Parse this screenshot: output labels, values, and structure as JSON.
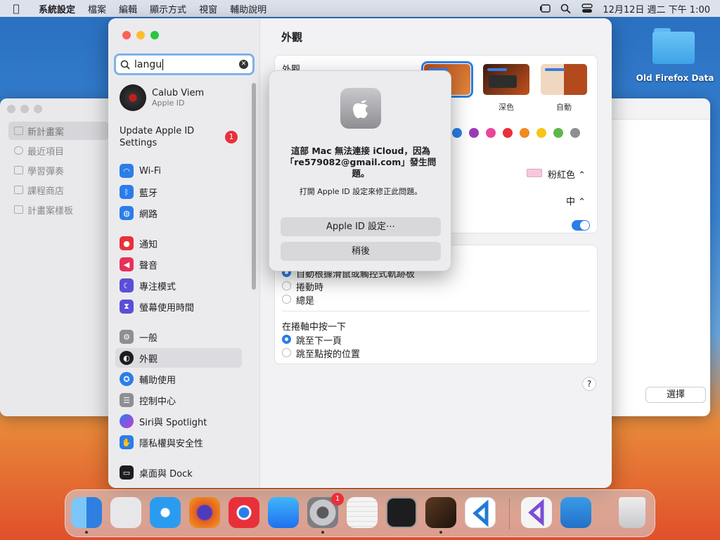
{
  "menubar": {
    "app": "系統設定",
    "items": [
      "檔案",
      "編輯",
      "顯示方式",
      "視窗",
      "輔助說明"
    ],
    "clock": "12月12日 週二 下午 1:00"
  },
  "desktop": {
    "folder_label": "Old Firefox Data"
  },
  "bg_window": {
    "items": [
      "新計畫案",
      "最近項目",
      "學習彈奏",
      "課程商店",
      "計畫案樣板"
    ],
    "select_button": "選擇"
  },
  "sidebar": {
    "search_value": "langu",
    "profile": {
      "name": "Calub Viem",
      "sub": "Apple ID"
    },
    "update": "Update Apple ID Settings",
    "update_badge": "1",
    "items": [
      {
        "label": "Wi-Fi",
        "color": "#2b7de9",
        "icon": "wifi-icon"
      },
      {
        "label": "藍牙",
        "color": "#2b7de9",
        "icon": "bluetooth-icon"
      },
      {
        "label": "網路",
        "color": "#2b7de9",
        "icon": "globe-icon"
      },
      {
        "label": "通知",
        "color": "#e8303a",
        "icon": "bell-icon"
      },
      {
        "label": "聲音",
        "color": "#e8305a",
        "icon": "speaker-icon"
      },
      {
        "label": "專注模式",
        "color": "#5b4fd6",
        "icon": "moon-icon"
      },
      {
        "label": "螢幕使用時間",
        "color": "#5b4fd6",
        "icon": "hourglass-icon"
      },
      {
        "label": "一般",
        "color": "#8e8e93",
        "icon": "gear-icon"
      },
      {
        "label": "外觀",
        "color": "#1d1d1f",
        "icon": "appearance-icon"
      },
      {
        "label": "輔助使用",
        "color": "#2b7de9",
        "icon": "accessibility-icon"
      },
      {
        "label": "控制中心",
        "color": "#8e8e93",
        "icon": "toggles-icon"
      },
      {
        "label": "Siri與 Spotlight",
        "color": "#a13bd6",
        "icon": "siri-icon"
      },
      {
        "label": "隱私權與安全性",
        "color": "#2b7de9",
        "icon": "hand-icon"
      },
      {
        "label": "桌面與 Dock",
        "color": "#1d1d1f",
        "icon": "dock-icon"
      }
    ]
  },
  "content": {
    "title": "外觀",
    "appearance_label": "外觀",
    "theme_captions": [
      "色",
      "深色",
      "自動"
    ],
    "accent_colors": [
      "#2b7de9",
      "#9b3bb8",
      "#e8469a",
      "#e8303a",
      "#f08a24",
      "#f5c518",
      "#5cb84a",
      "#8e8e93"
    ],
    "highlight_value": "粉紅色",
    "sidebar_size_value": "中",
    "scroll_options": [
      "自動根據滑鼠或觸控式軌跡板",
      "捲動時",
      "總是"
    ],
    "click_section": "在捲軸中按一下",
    "click_options": [
      "跳至下一頁",
      "跳至點按的位置"
    ],
    "help": "?"
  },
  "dialog": {
    "title": "這部 Mac 無法連接 iCloud，因為「re579082@gmail.com」發生問題。",
    "message": "打開 Apple ID 設定來修正此問題。",
    "primary": "Apple ID 設定⋯",
    "secondary": "稍後"
  },
  "dock": {
    "badge": "1",
    "apps": [
      {
        "name": "finder-icon",
        "color": "#3b8ee8",
        "dot": true
      },
      {
        "name": "launchpad-icon",
        "color": "#e7e7ea",
        "dot": false
      },
      {
        "name": "safari-icon",
        "color": "#2a9cf0",
        "dot": false
      },
      {
        "name": "firefox-icon",
        "color": "#e35d21",
        "dot": false
      },
      {
        "name": "chrome-icon",
        "color": "#f0f0f0",
        "dot": false
      },
      {
        "name": "app-store-icon",
        "color": "#1f8ff0",
        "dot": false
      },
      {
        "name": "system-settings-icon",
        "color": "#7d7d82",
        "dot": true
      },
      {
        "name": "textedit-icon",
        "color": "#f4f4f4",
        "dot": false
      },
      {
        "name": "terminal-icon",
        "color": "#1d1d1f",
        "dot": false
      },
      {
        "name": "garageband-icon",
        "color": "#3a2a20",
        "dot": true
      },
      {
        "name": "vscode-icon",
        "color": "#1f7ad6",
        "dot": false
      },
      {
        "name": "visual-studio-icon",
        "color": "#f4f4f4",
        "dot": false
      },
      {
        "name": "weather-icon",
        "color": "#3a9be8",
        "dot": false
      },
      {
        "name": "trash-icon",
        "color": "#d8d8dc",
        "dot": false
      }
    ]
  }
}
